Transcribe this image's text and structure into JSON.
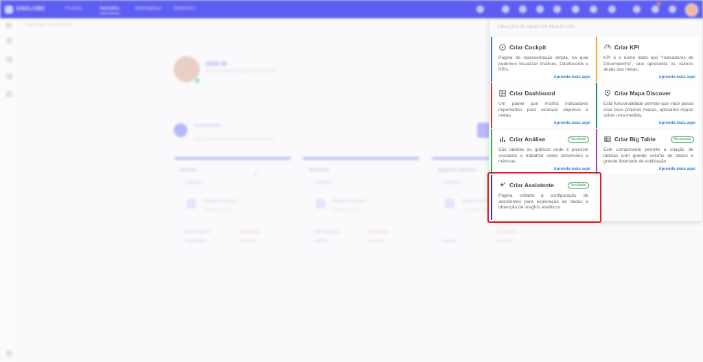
{
  "app": {
    "logo_text": "ENGLOBE",
    "nav": [
      "Produto",
      "Apoiados",
      "Marketplace",
      "Relatórios"
    ],
    "active_nav_index": 1,
    "brand_color": "#5b5ef1"
  },
  "breadcrumb": "Catálogo / Conteúdos",
  "profile": {
    "name": "ADA IA",
    "subtitle": "Sua assistente analítica de BI/Análises"
  },
  "section": {
    "title": "Assistentes",
    "subtitle": "Veja e Gerencie seus Assistentes de análise"
  },
  "columns": [
    {
      "title": "Vendas",
      "link": "+ Adicionar",
      "num": "0",
      "card_title": "Objetos Atribuídos",
      "card_sub": "1 Assistente criado",
      "foot_a": "Valor negativo",
      "foot_b": "Atualização",
      "foot_c": "Prognóstico",
      "foot_d": "Consulta"
    },
    {
      "title": "Diretoria",
      "link": "+ Adicionar",
      "num": "",
      "card_title": "Objetos Atribuídos",
      "card_sub": "1 Assistente criado",
      "foot_a": "Valor negativo",
      "foot_b": "Atualização",
      "foot_c": "Análise",
      "foot_d": "Consulta"
    },
    {
      "title": "Suporte Técnico",
      "link": "+ Adicionar",
      "num": "",
      "card_title": "Objetos Atribuídos",
      "card_sub": "1 Assistente criado",
      "foot_a": "",
      "foot_b": "Atualização",
      "foot_c": "Análise",
      "foot_d": "Consulta"
    }
  ],
  "panel": {
    "header": "CRIAÇÃO DE OBJETOS ANALÍTICOS",
    "cards": [
      {
        "icon": "compass-icon",
        "title": "Criar Cockpit",
        "tag": "",
        "desc": "Página de representação ampla, na qual podemos visualizar Análises, Dashboards e KPIs.",
        "link": "Aprenda mais aqui",
        "color": "#3b6fe0"
      },
      {
        "icon": "gauge-icon",
        "title": "Criar KPI",
        "tag": "",
        "desc": "KPI é o nome dado aos \"Indicadores de Desempenho\", que apresenta os valores atuais das metas.",
        "link": "Aprenda mais aqui",
        "color": "#f5a623"
      },
      {
        "icon": "dashboard-icon",
        "title": "Criar Dashboard",
        "tag": "",
        "desc": "Um painel que mostra indicadores importantes para alcançar objetivos e metas.",
        "link": "Aprenda mais aqui",
        "color": "#e0302a"
      },
      {
        "icon": "map-pin-icon",
        "title": "Criar Mapa Discover",
        "tag": "",
        "desc": "Esta funcionalidade permite que você possa criar seus próprios mapas, aplicando regras sobre uma medida.",
        "link": "Aprenda mais aqui",
        "color": "#1f8a7a"
      },
      {
        "icon": "bar-chart-icon",
        "title": "Criar Análise",
        "tag": "Novidade",
        "desc": "São tabelas ou gráficos onde é possível visualizar e trabalhar sobre dimensões e métricas.",
        "link": "Aprenda mais aqui",
        "color": "#2fa84f"
      },
      {
        "icon": "table-icon",
        "title": "Criar Big Table",
        "tag": "Atualizado",
        "desc": "Este componente permite a criação de tabelas com grande volume de dados e grande liberdade de estilização",
        "link": "Aprenda mais aqui",
        "color": "#a040c8"
      },
      {
        "icon": "sparkle-icon",
        "title": "Criar Assistente",
        "tag": "Novidade",
        "desc": "Página voltada à configuração de assistentes para exploração de dados e obtenção de insights analíticos.",
        "link": "",
        "color": "#3a2fd0"
      }
    ]
  }
}
